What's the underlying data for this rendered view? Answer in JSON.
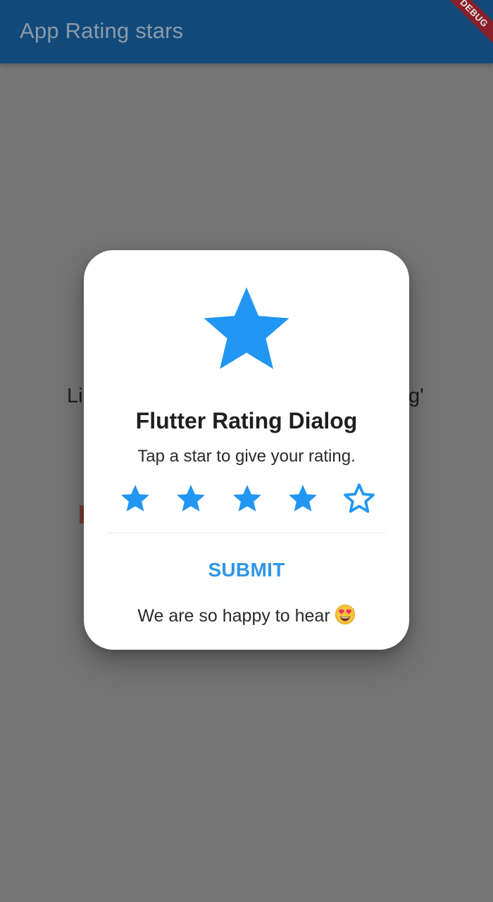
{
  "app_bar": {
    "title": "App Rating stars",
    "debug_banner": "DEBUG"
  },
  "background": {
    "text_left": "Li",
    "text_right": "g'"
  },
  "dialog": {
    "title": "Flutter Rating Dialog",
    "message": "Tap a star to give your rating.",
    "rating": {
      "value": 4,
      "max": 5
    },
    "submit_label": "SUBMIT",
    "feedback": "We are so happy to hear",
    "feedback_emoji_icon": "heart-eyes-emoji-icon"
  },
  "colors": {
    "accent": "#2196F3",
    "submit": "#2f96e6",
    "app_bar": "#114a7a",
    "scrim_bg": "#747474"
  }
}
